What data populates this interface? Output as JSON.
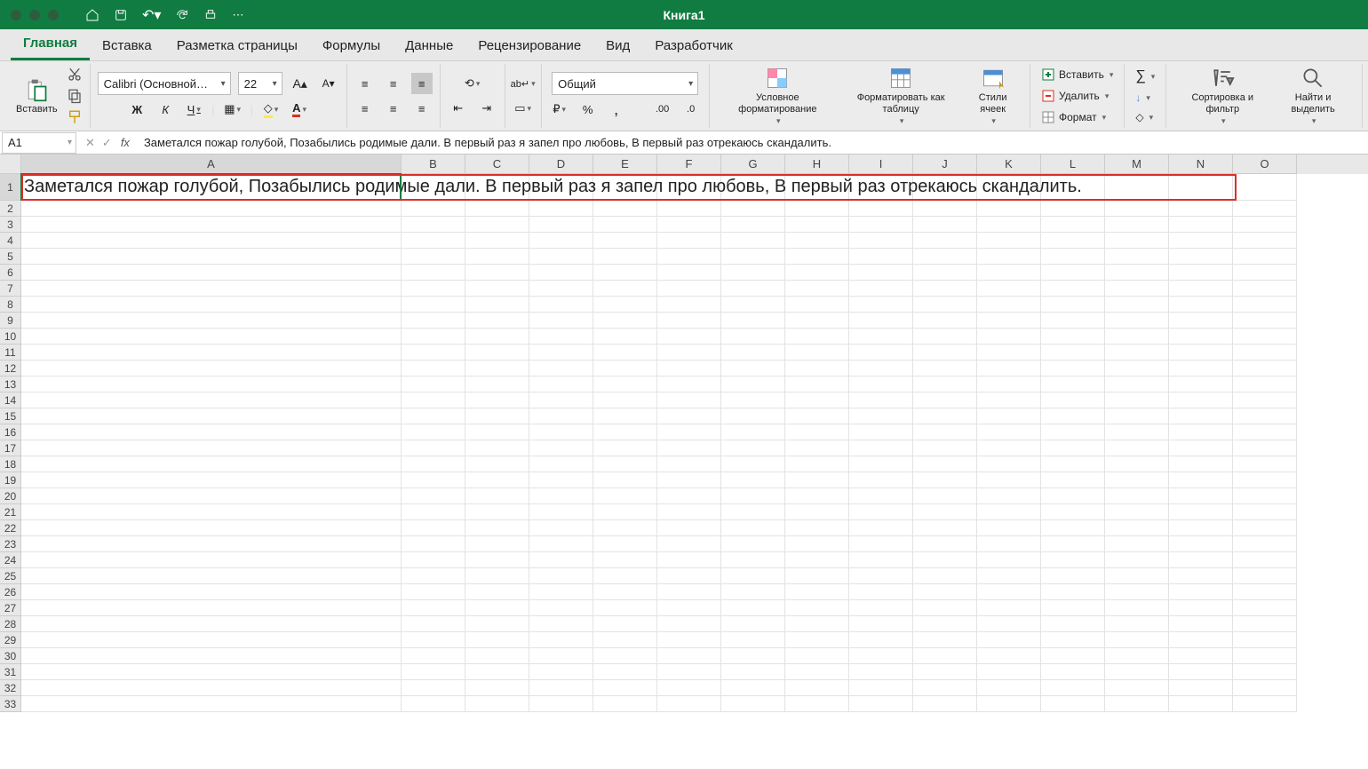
{
  "title": "Книга1",
  "tabs": [
    "Главная",
    "Вставка",
    "Разметка страницы",
    "Формулы",
    "Данные",
    "Рецензирование",
    "Вид",
    "Разработчик"
  ],
  "activeTab": 0,
  "ribbon": {
    "paste": "Вставить",
    "font": {
      "name": "Calibri (Основной…",
      "size": "22",
      "bold": "Ж",
      "italic": "К",
      "underline": "Ч"
    },
    "number": {
      "format": "Общий"
    },
    "cond": "Условное форматирование",
    "table": "Форматировать как таблицу",
    "styles": "Стили ячеек",
    "insert": "Вставить",
    "delete": "Удалить",
    "format": "Формат",
    "sort": "Сортировка и фильтр",
    "find": "Найти и выделить"
  },
  "namebox": "A1",
  "formula": "Заметался пожар голубой, Позабылись родимые дали. В первый раз я запел про любовь, В первый раз отрекаюсь скандалить.",
  "cols": [
    "A",
    "B",
    "C",
    "D",
    "E",
    "F",
    "G",
    "H",
    "I",
    "J",
    "K",
    "L",
    "M",
    "N",
    "O"
  ],
  "rowCount": 33,
  "cellA1": "Заметался пожар голубой, Позабылись родимые дали. В первый раз я запел про любовь, В первый раз отрекаюсь скандалить."
}
